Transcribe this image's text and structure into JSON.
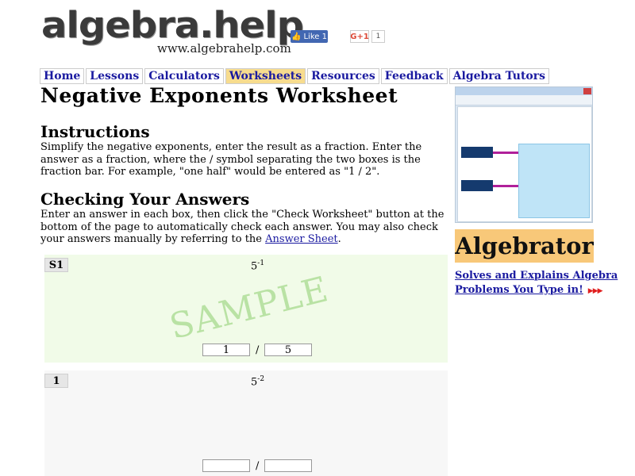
{
  "header": {
    "logo": "algebra.help",
    "url": "www.algebrahelp.com",
    "fb_like": "Like 1",
    "gplus": "G+1",
    "gplus_count": "1"
  },
  "nav": {
    "items": [
      "Home",
      "Lessons",
      "Calculators",
      "Worksheets",
      "Resources",
      "Feedback",
      "Algebra Tutors"
    ],
    "active": "Worksheets"
  },
  "page": {
    "title": "Negative Exponents Worksheet",
    "instructions_heading": "Instructions",
    "instructions_text": "Simplify the negative exponents, enter the result as a fraction. Enter the answer as a fraction, where the / symbol separating the two boxes is the fraction bar. For example, \"one half\" would be entered as \"1 / 2\".",
    "checking_heading": "Checking Your Answers",
    "checking_text": "Enter an answer in each box, then click the \"Check Worksheet\" button at the bottom of the page to automatically check each answer.  You may also check your answers manually by referring to the",
    "answer_sheet_link": "Answer Sheet",
    "checking_tail": "."
  },
  "problems": [
    {
      "label": "S1",
      "base": "5",
      "exponent": "-1",
      "stamp": "SAMPLE",
      "numerator": "1",
      "denominator": "5",
      "slash": "/"
    },
    {
      "label": "1",
      "base": "5",
      "exponent": "-2",
      "numerator": "",
      "denominator": "",
      "slash": "/"
    }
  ],
  "sidebar": {
    "ad_title": "Algebrator",
    "ad_line1": "Solves and Explains Algebra",
    "ad_line2": "Problems You Type in!",
    "ad_arrows": "▶▶▶"
  }
}
